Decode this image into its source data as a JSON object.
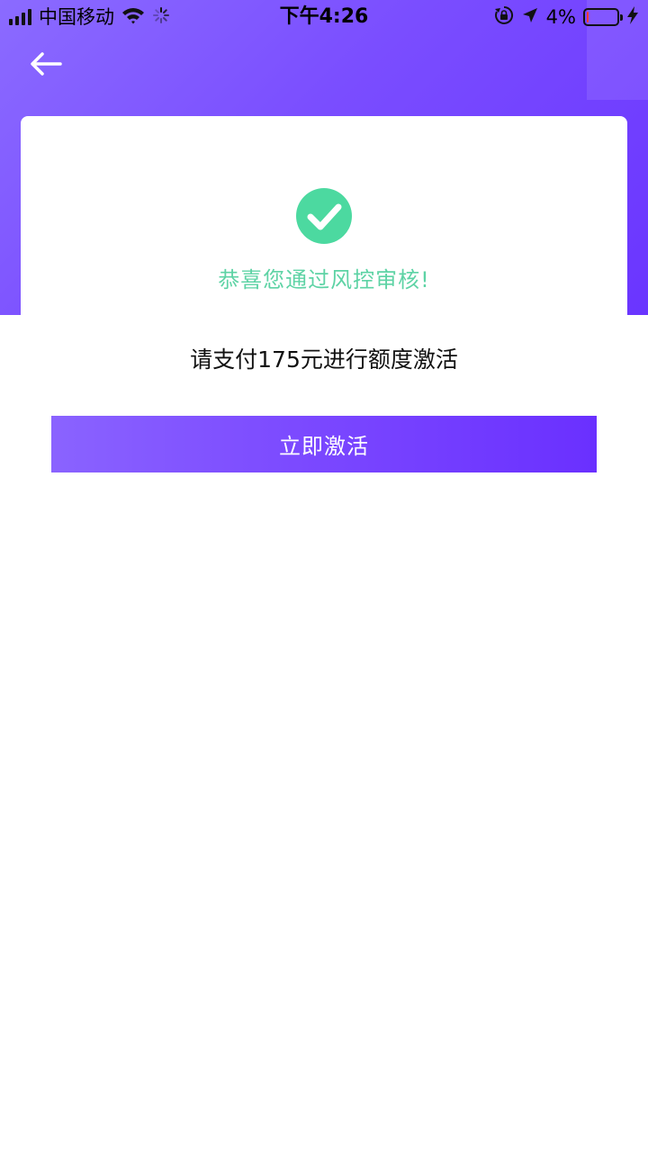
{
  "status_bar": {
    "carrier": "中国移动",
    "time": "下午4:26",
    "battery_percent": "4%",
    "battery_level": 0.04,
    "icons": [
      "signal-icon",
      "wifi-icon",
      "loading-spinner-icon",
      "orientation-lock-icon",
      "location-arrow-icon",
      "battery-icon",
      "charging-bolt-icon"
    ]
  },
  "nav": {
    "back_icon": "arrow-left-icon"
  },
  "result": {
    "icon": "check-circle-icon",
    "message": "恭喜您通过风控审核!"
  },
  "payment": {
    "prompt": "请支付175元进行额度激活"
  },
  "action": {
    "activate_label": "立即激活"
  },
  "colors": {
    "header_gradient_start": "#8b6bff",
    "header_gradient_end": "#6a35ff",
    "success_green": "#4cd9a0",
    "success_text": "#5ed3a5",
    "button_gradient_start": "#8a63ff",
    "button_gradient_end": "#6a30ff"
  }
}
